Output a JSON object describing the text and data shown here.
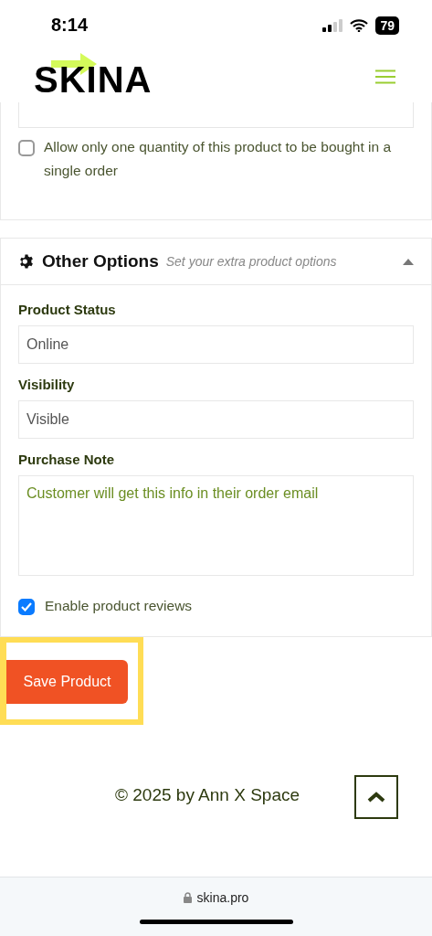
{
  "status_bar": {
    "time": "8:14",
    "battery": "79"
  },
  "header": {
    "logo": "SKINA"
  },
  "stock_card": {
    "single_order": {
      "label": "Allow only one quantity of this product to be bought in a single order",
      "checked": false
    }
  },
  "options_panel": {
    "title": "Other Options",
    "subtitle": "Set your extra product options",
    "expanded": true,
    "fields": [
      {
        "kind": "input",
        "label": "Product Status",
        "value": "Online"
      },
      {
        "kind": "input",
        "label": "Visibility",
        "value": "Visible"
      },
      {
        "kind": "textarea",
        "label": "Purchase Note",
        "placeholder": "Customer will get this info in their order email"
      }
    ],
    "reviews": {
      "label": "Enable product reviews",
      "checked": true
    }
  },
  "save_button": "Save Product",
  "footer": {
    "copyright": "© 2025 by Ann X Space"
  },
  "browser_bar": {
    "url": "skina.pro"
  }
}
